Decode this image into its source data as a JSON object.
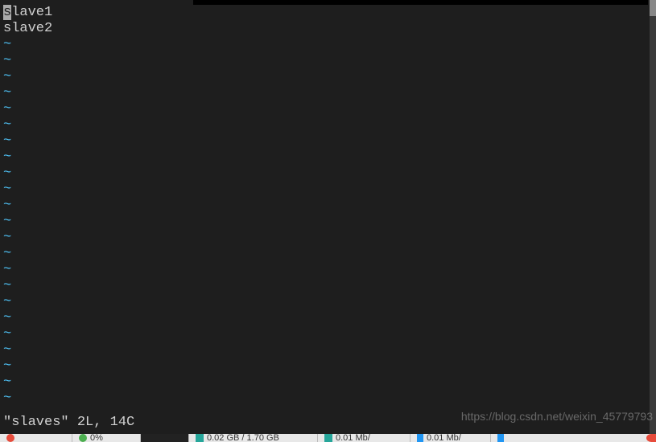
{
  "editor": {
    "lines": [
      "slave1",
      "slave2"
    ],
    "cursor_char": "s",
    "tilde_char": "~",
    "tilde_count": 23,
    "status": "\"slaves\" 2L, 14C"
  },
  "watermark": "https://blog.csdn.net/weixin_45779793",
  "taskbar": {
    "cpu_percent": "0%",
    "net_down": "0.01 Mb/",
    "net_up": "0.01 Mb/",
    "mem": "0.02 GB / 1.70 GB"
  }
}
